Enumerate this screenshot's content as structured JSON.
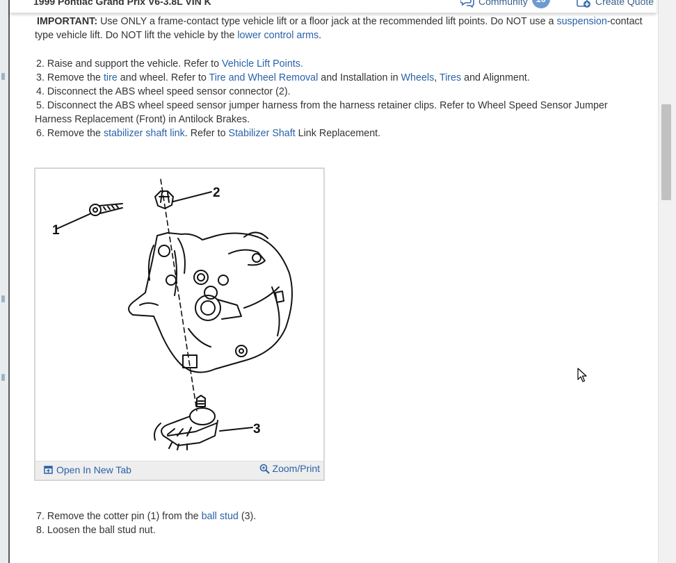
{
  "header": {
    "vehicle": "1999 Pontiac Grand Prix V6-3.8L VIN K",
    "community_label": "Community",
    "community_count": "10",
    "create_quote_label": "Create Quote"
  },
  "important": {
    "label": "IMPORTANT:",
    "text_1": " Use ONLY a frame-contact type vehicle lift or a floor jack at the recommended lift points. Do NOT use a ",
    "link_suspension": "suspension",
    "text_2": "-contact type vehicle lift. Do NOT lift the vehicle by the ",
    "link_lower_control_arms": "lower control arms",
    "text_3": "."
  },
  "steps": {
    "s2_text": "2. Raise and support the vehicle. Refer to ",
    "s2_link": "Vehicle Lift Points",
    "s2_end": ".",
    "s3_text_a": "3. Remove the ",
    "s3_link_tire": "tire",
    "s3_text_b": " and wheel. Refer to ",
    "s3_link_twr": "Tire and Wheel Removal",
    "s3_text_c": " and Installation in ",
    "s3_link_wheels": "Wheels",
    "s3_text_d": ", ",
    "s3_link_tires": "Tires",
    "s3_text_e": " and Alignment.",
    "s4_text": "4. Disconnect the ABS wheel speed sensor connector (2).",
    "s5_text": "5. Disconnect the ABS wheel speed sensor jumper harness from the harness retainer clips. Refer to Wheel Speed Sensor Jumper Harness Replacement (Front) in Antilock Brakes.",
    "s6_text_a": "6. Remove the ",
    "s6_link_ssl": "stabilizer shaft link",
    "s6_text_b": ". Refer to ",
    "s6_link_ss": "Stabilizer Shaft",
    "s6_text_c": " Link Replacement.",
    "s7_text_a": "7. Remove the cotter pin (1) from the ",
    "s7_link": "ball stud",
    "s7_text_b": " (3).",
    "s8_text": "8. Loosen the ball stud nut."
  },
  "figure": {
    "callout_1": "1",
    "callout_2": "2",
    "callout_3": "3",
    "open_tab_label": "Open In New Tab",
    "zoom_label": "Zoom/Print"
  }
}
